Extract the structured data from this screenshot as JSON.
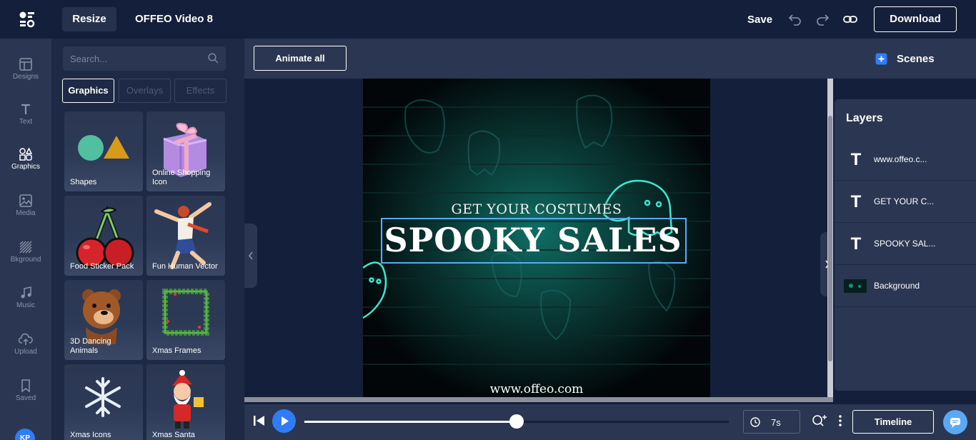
{
  "header": {
    "resize_label": "Resize",
    "project_title": "OFFEO Video 8",
    "save_label": "Save",
    "download_label": "Download"
  },
  "rail": {
    "items": [
      {
        "label": "Designs",
        "icon": "layout-icon"
      },
      {
        "label": "Text",
        "icon": "text-icon"
      },
      {
        "label": "Graphics",
        "icon": "shapes-icon",
        "active": true
      },
      {
        "label": "Media",
        "icon": "image-icon"
      },
      {
        "label": "Bkground",
        "icon": "pattern-icon"
      },
      {
        "label": "Music",
        "icon": "music-icon"
      },
      {
        "label": "Upload",
        "icon": "cloud-upload-icon"
      },
      {
        "label": "Saved",
        "icon": "bookmark-icon"
      }
    ],
    "avatar_initials": "KP"
  },
  "panel": {
    "search_placeholder": "Search...",
    "filters": [
      "Graphics",
      "Overlays",
      "Effects"
    ],
    "active_filter": "Graphics",
    "cards": [
      "Shapes",
      "Online Shopping Icon",
      "Food Sticker Pack",
      "Fun Human Vector",
      "3D Dancing Animals",
      "Xmas Frames",
      "Xmas Icons",
      "Xmas Santa"
    ]
  },
  "canvas": {
    "animate_all_label": "Animate all",
    "subtitle": "GET YOUR COSTUMES",
    "headline": "SPOOKY SALES",
    "url": "www.offeo.com"
  },
  "right": {
    "scenes_label": "Scenes",
    "layers_title": "Layers",
    "layers": [
      {
        "type": "text",
        "icon": "T",
        "label": "www.offeo.c..."
      },
      {
        "type": "text",
        "icon": "T",
        "label": "GET YOUR C..."
      },
      {
        "type": "text",
        "icon": "T",
        "label": "SPOOKY SAL..."
      },
      {
        "type": "image",
        "icon": "",
        "label": "Background"
      }
    ]
  },
  "timeline": {
    "progress": 0.5,
    "duration": "7s",
    "timeline_label": "Timeline"
  },
  "colors": {
    "topbar": "#14203b",
    "panel": "#2b3752",
    "accent": "#2f7cf6",
    "neon": "#3fe6d0"
  }
}
